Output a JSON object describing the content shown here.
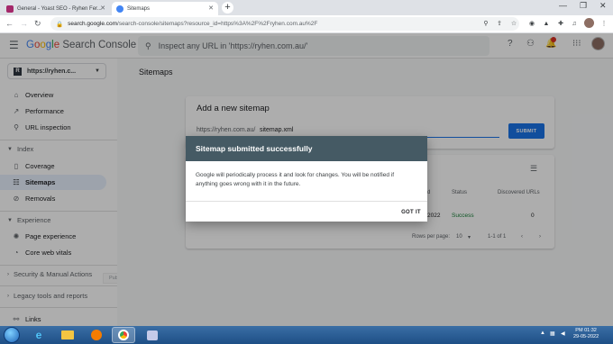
{
  "browser": {
    "tabs": [
      {
        "label": "General - Yoast SEO - Ryhen Fer..."
      },
      {
        "label": "Sitemaps"
      }
    ],
    "url_prefix": "search.google.com",
    "url_rest": "/search-console/sitemaps?resource_id=https%3A%2F%2Fryhen.com.au%2F"
  },
  "app": {
    "brand_google": [
      "G",
      "o",
      "o",
      "g",
      "l",
      "e"
    ],
    "brand_rest": "Search Console",
    "inspect_placeholder": "Inspect any URL in 'https://ryhen.com.au/'",
    "property": "https://ryhen.c..."
  },
  "sidebar": {
    "items": [
      {
        "label": "Overview",
        "icon": "home-icon"
      },
      {
        "label": "Performance",
        "icon": "trending-icon"
      },
      {
        "label": "URL inspection",
        "icon": "search-icon"
      }
    ],
    "index_label": "Index",
    "index_items": [
      {
        "label": "Coverage",
        "icon": "file-icon"
      },
      {
        "label": "Sitemaps",
        "icon": "sitemap-icon"
      },
      {
        "label": "Removals",
        "icon": "eye-off-icon"
      }
    ],
    "experience_label": "Experience",
    "experience_items": [
      {
        "label": "Page experience",
        "icon": "gear-icon"
      },
      {
        "label": "Core web vitals",
        "icon": "gauge-icon"
      }
    ],
    "security_label": "Security & Manual Actions",
    "legacy_label": "Legacy tools and reports",
    "links_label": "Links",
    "pub_help": "Pub screen help"
  },
  "main": {
    "page_title": "Sitemaps",
    "add_title": "Add a new sitemap",
    "url_prefix": "https://ryhen.com.au/",
    "url_value": "sitemap.xml",
    "submit_label": "SUBMIT",
    "table": {
      "headers": {
        "date": "d",
        "status": "Status",
        "urls": "Discovered URLs"
      },
      "row": {
        "date": "2022",
        "status": "Success",
        "urls": "0"
      },
      "rows_per_page_label": "Rows per page:",
      "rows_per_page_value": "10",
      "range": "1-1 of 1"
    }
  },
  "dialog": {
    "title": "Sitemap submitted successfully",
    "body": "Google will periodically process it and look for changes. You will be notified if anything goes wrong with it in the future.",
    "button": "GOT IT"
  },
  "taskbar": {
    "time": "PM 01:32",
    "date": "29-05-2022"
  },
  "colors": {
    "accent": "#1a73e8",
    "dialog_header": "#455a64",
    "success": "#188038",
    "active_nav": "#e8f0fe"
  }
}
